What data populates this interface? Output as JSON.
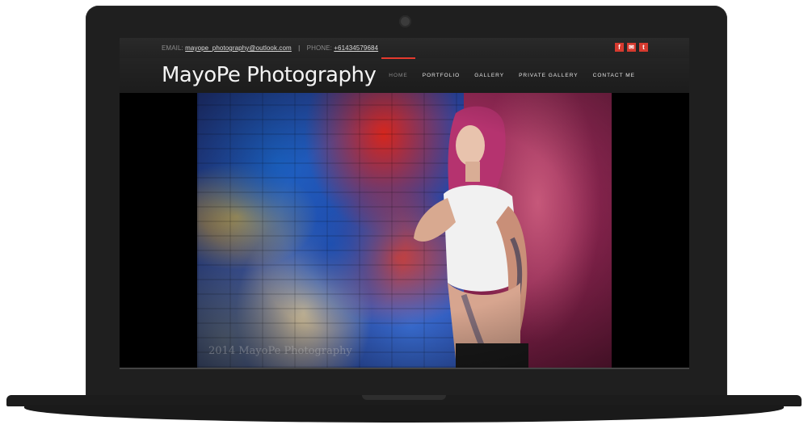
{
  "site": {
    "logo": "MayoPe Photography"
  },
  "topbar": {
    "email_label": "EMAIL:",
    "email": "mayope_photography@outlook.com",
    "separator": "|",
    "phone_label": "PHONE:",
    "phone": "+61434579684",
    "social": [
      {
        "name": "facebook-icon",
        "glyph": "f"
      },
      {
        "name": "email-icon",
        "glyph": "✉"
      },
      {
        "name": "tumblr-icon",
        "glyph": "t"
      }
    ]
  },
  "nav": {
    "items": [
      {
        "label": "HOME",
        "active": true
      },
      {
        "label": "PORTFOLIO",
        "active": false
      },
      {
        "label": "GALLERY",
        "active": false
      },
      {
        "label": "PRIVATE GALLERY",
        "active": false
      },
      {
        "label": "CONTACT ME",
        "active": false
      }
    ]
  },
  "hero": {
    "watermark": "2014 MayoPe Photography"
  },
  "colors": {
    "accent": "#e53a2e",
    "social": "#d63a2f"
  }
}
